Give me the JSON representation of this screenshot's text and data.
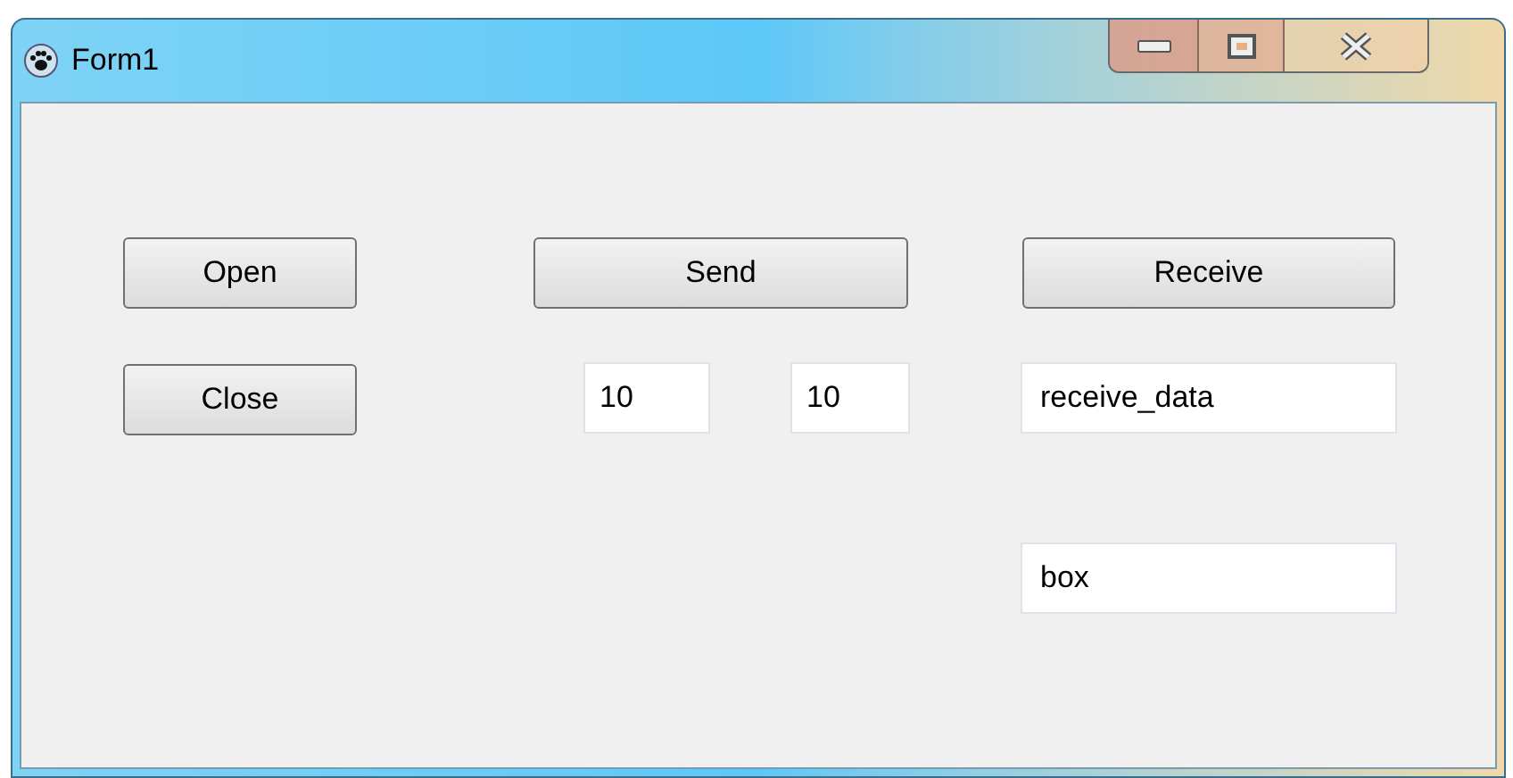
{
  "window": {
    "title": "Form1"
  },
  "buttons": [
    {
      "label": "Open"
    },
    {
      "label": "Close"
    },
    {
      "label": "Send"
    },
    {
      "label": "Receive"
    }
  ],
  "fields": [
    {
      "value": "10"
    },
    {
      "value": "10"
    },
    {
      "value": "receive_data"
    },
    {
      "value": "box"
    }
  ]
}
